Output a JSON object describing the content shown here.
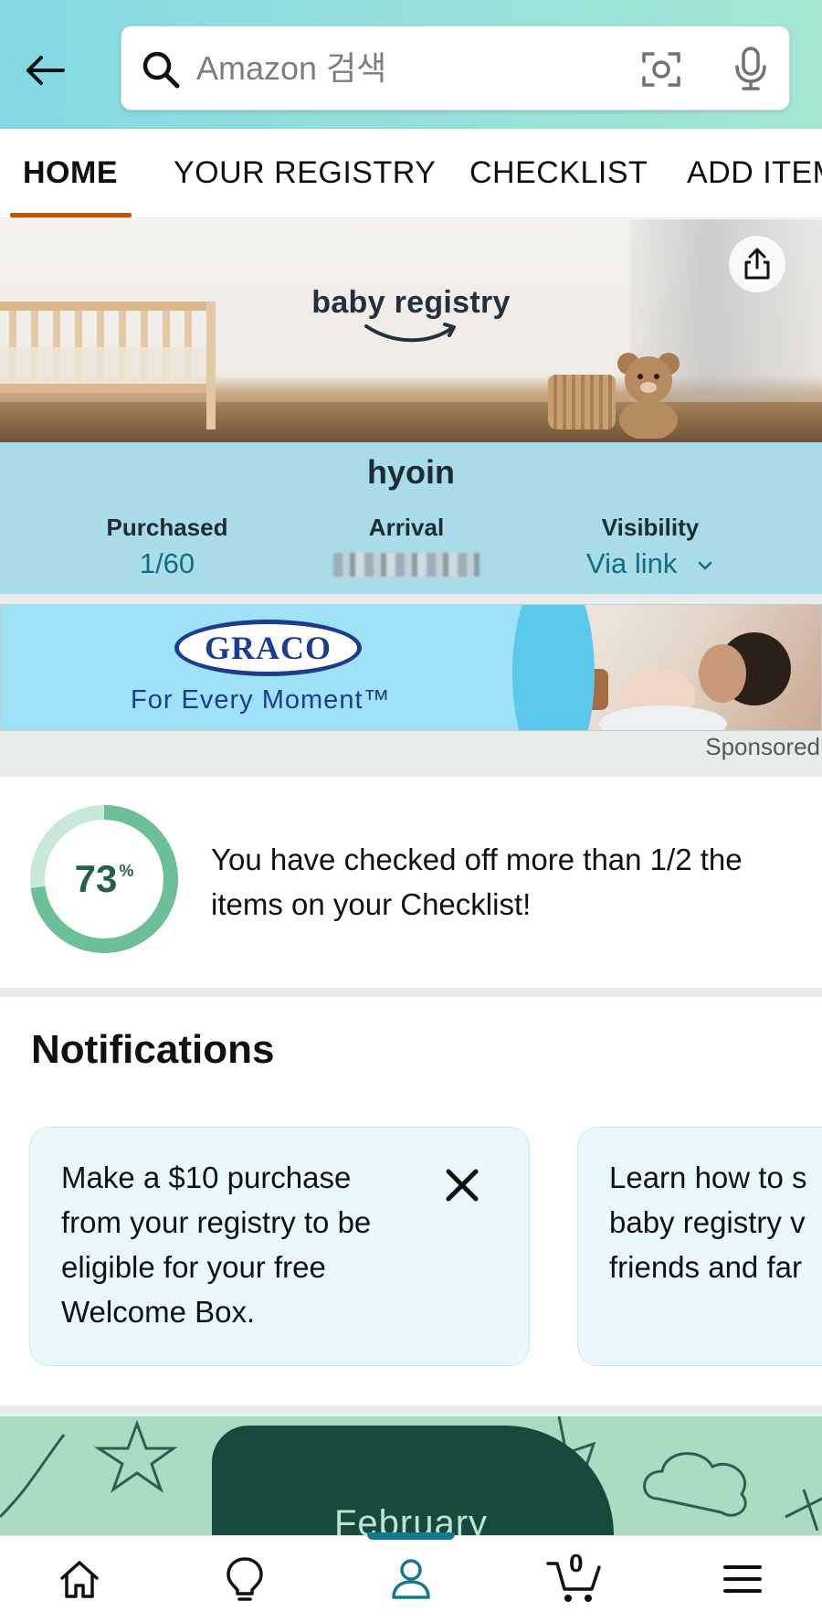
{
  "search": {
    "placeholder": "Amazon 검색"
  },
  "tabs": [
    {
      "label": "HOME",
      "active": true
    },
    {
      "label": "YOUR REGISTRY",
      "active": false
    },
    {
      "label": "CHECKLIST",
      "active": false
    },
    {
      "label": "ADD ITEM",
      "active": false
    }
  ],
  "banner": {
    "logo_text": "baby registry"
  },
  "registry": {
    "name": "hyoin",
    "purchased_label": "Purchased",
    "purchased_value": "1/60",
    "arrival_label": "Arrival",
    "visibility_label": "Visibility",
    "visibility_value": "Via link"
  },
  "ad": {
    "brand": "GRACO",
    "tagline": "For Every Moment™",
    "sponsored_label": "Sponsored"
  },
  "checklist_progress": {
    "percent": 73,
    "percent_value": "73",
    "percent_sign": "%",
    "message": "You have checked off more than 1/2 the items on your Checklist!"
  },
  "notifications": {
    "title": "Notifications",
    "cards": [
      {
        "text_lines": [
          "Make a $10 purchase",
          "from your registry to be",
          "eligible for your free",
          "Welcome Box."
        ]
      },
      {
        "text_lines": [
          "Learn how to s",
          "baby registry v",
          "friends and far"
        ]
      }
    ]
  },
  "month_banner": {
    "label": "February"
  },
  "bottom_nav": {
    "items": [
      "home-icon",
      "lightbulb-icon",
      "profile-icon",
      "cart-icon",
      "menu-icon"
    ],
    "active": "profile-icon",
    "cart_count": "0"
  },
  "colors": {
    "header_gradient_start": "#84d8e3",
    "header_gradient_end": "#a5e7d3",
    "tab_underline": "#c45500",
    "info_band": "#a9dbe9",
    "link_teal": "#0e6f83",
    "progress_ring": "#6dbf9a",
    "notification_card": "#e8f8fd",
    "nav_active": "#127a8a"
  }
}
